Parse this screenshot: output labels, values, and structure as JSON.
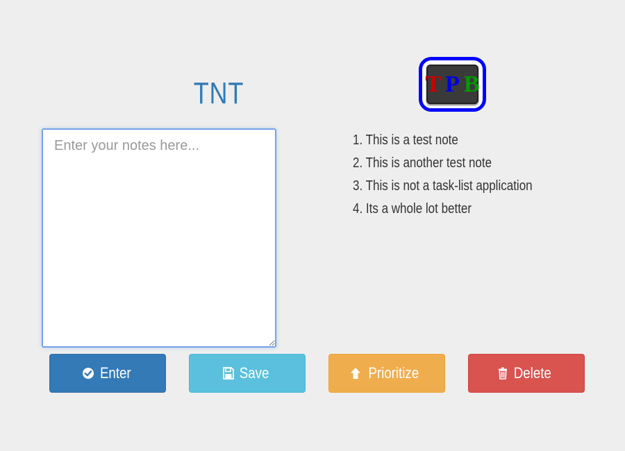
{
  "header": {
    "title": "TNT"
  },
  "logo": {
    "letters": [
      "T",
      "P",
      "B"
    ],
    "colors": [
      "#cc0000",
      "#0000dd",
      "#009900"
    ],
    "border_color": "#0000ff"
  },
  "editor": {
    "placeholder": "Enter your notes here...",
    "value": ""
  },
  "notes": {
    "items": [
      {
        "number": "1.",
        "text": "This is a test note"
      },
      {
        "number": "2.",
        "text": "This is another test note"
      },
      {
        "number": "3.",
        "text": "This is not a task-list application"
      },
      {
        "number": "4.",
        "text": "Its a whole lot better"
      }
    ]
  },
  "buttons": {
    "enter": {
      "label": "Enter",
      "icon": "check-circle-icon",
      "color": "#337ab7"
    },
    "save": {
      "label": "Save",
      "icon": "floppy-disk-icon",
      "color": "#5bc0de"
    },
    "prioritize": {
      "label": "Prioritize",
      "icon": "arrow-up-icon",
      "color": "#f0ad4e"
    },
    "delete": {
      "label": "Delete",
      "icon": "trash-icon",
      "color": "#d9534f"
    }
  }
}
